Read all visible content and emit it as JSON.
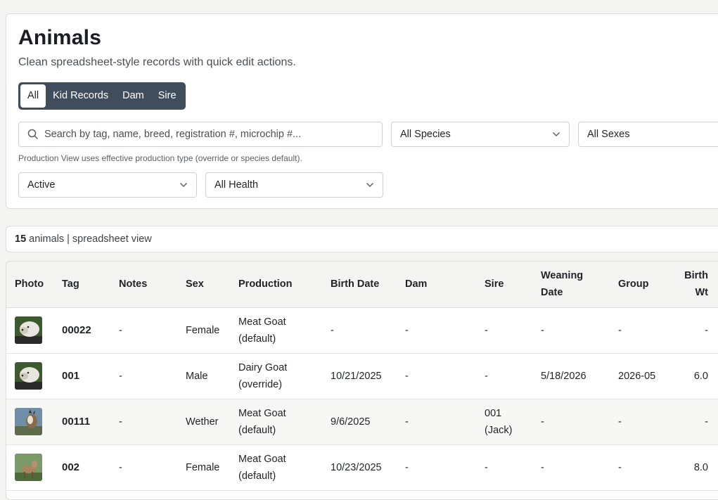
{
  "header": {
    "title": "Animals",
    "subtitle": "Clean spreadsheet-style records with quick edit actions."
  },
  "tabs": [
    {
      "label": "All",
      "active": true
    },
    {
      "label": "Kid Records",
      "active": false
    },
    {
      "label": "Dam",
      "active": false
    },
    {
      "label": "Sire",
      "active": false
    }
  ],
  "filters": {
    "search_placeholder": "Search by tag, name, breed, registration #, microchip #...",
    "species": "All Species",
    "sex": "All Sexes",
    "hint": "Production View uses effective production type (override or species default).",
    "status": "Active",
    "health": "All Health"
  },
  "summary": {
    "count": "15",
    "label": "animals | spreadsheet view"
  },
  "table": {
    "columns": {
      "photo": "Photo",
      "tag": "Tag",
      "notes": "Notes",
      "sex": "Sex",
      "production": "Production",
      "birth_date": "Birth Date",
      "dam": "Dam",
      "sire": "Sire",
      "weaning_line1": "Weaning",
      "weaning_line2": "Date",
      "group": "Group",
      "birth_wt_line1": "Birth",
      "birth_wt_line2": "Wt"
    },
    "rows": [
      {
        "photo": "goat-white-photo",
        "tag": "00022",
        "notes": "-",
        "sex": "Female",
        "prod1": "Meat Goat",
        "prod2": "(default)",
        "birth_date": "-",
        "dam": "-",
        "sire1": "-",
        "sire2": "",
        "weaning": "-",
        "group": "-",
        "birth_wt": "-"
      },
      {
        "photo": "goat-white-photo",
        "tag": "001",
        "notes": "-",
        "sex": "Male",
        "prod1": "Dairy Goat",
        "prod2": "(override)",
        "birth_date": "10/21/2025",
        "dam": "-",
        "sire1": "-",
        "sire2": "",
        "weaning": "5/18/2026",
        "group": "2026-05",
        "birth_wt": "6.0"
      },
      {
        "photo": "goat-brown-photo",
        "tag": "00111",
        "notes": "-",
        "sex": "Wether",
        "prod1": "Meat Goat",
        "prod2": "(default)",
        "birth_date": "9/6/2025",
        "dam": "-",
        "sire1": "001",
        "sire2": "(Jack)",
        "weaning": "-",
        "group": "-",
        "birth_wt": "-"
      },
      {
        "photo": "goat-brown-photo",
        "tag": "002",
        "notes": "-",
        "sex": "Female",
        "prod1": "Meat Goat",
        "prod2": "(default)",
        "birth_date": "10/23/2025",
        "dam": "-",
        "sire1": "-",
        "sire2": "",
        "weaning": "-",
        "group": "-",
        "birth_wt": "8.0"
      }
    ]
  },
  "colors": {
    "segment_bg": "#3f4d5c",
    "header_bg": "#f4f4f2",
    "page_bg": "#f4f4f2"
  }
}
